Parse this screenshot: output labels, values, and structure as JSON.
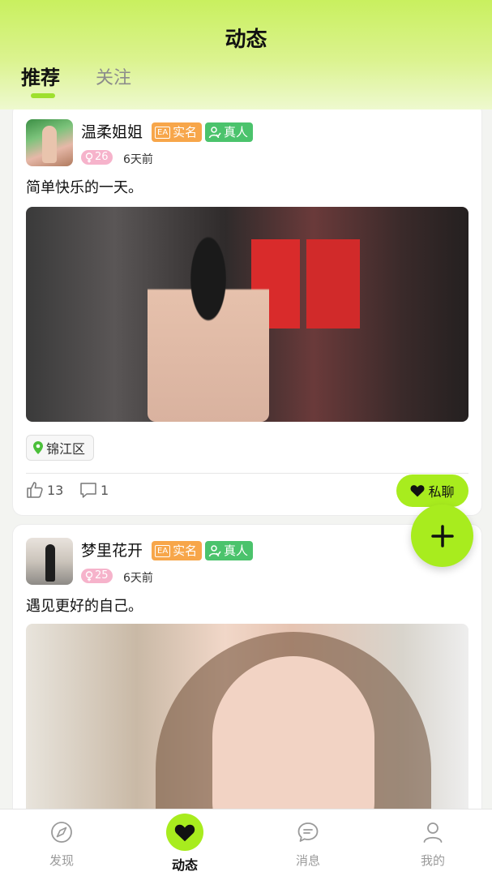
{
  "status_bar": {
    "left": "",
    "right": ""
  },
  "header": {
    "title": "动态",
    "tabs": [
      {
        "label": "推荐",
        "active": true
      },
      {
        "label": "关注",
        "active": false
      }
    ]
  },
  "posts": [
    {
      "username": "温柔姐姐",
      "badge_realname_icon": "EA",
      "badge_realname": "实名",
      "badge_realperson": "真人",
      "age": "26",
      "time": "6天前",
      "text": "简单快乐的一天。",
      "location": "锦江区",
      "likes": "13",
      "comments": "1",
      "chat_label": "私聊"
    },
    {
      "username": "梦里花开",
      "badge_realname_icon": "EA",
      "badge_realname": "实名",
      "badge_realperson": "真人",
      "age": "25",
      "time": "6天前",
      "text": "遇见更好的自己。"
    }
  ],
  "fab": {
    "icon": "plus-icon"
  },
  "bottom_nav": [
    {
      "label": "发现",
      "icon": "compass-icon",
      "active": false
    },
    {
      "label": "动态",
      "icon": "heart-icon",
      "active": true
    },
    {
      "label": "消息",
      "icon": "chat-bubble-icon",
      "active": false
    },
    {
      "label": "我的",
      "icon": "person-icon",
      "active": false
    }
  ],
  "colors": {
    "accent": "#a8ec1e",
    "header_top": "#c9f05f",
    "badge_realname": "#f7a64a",
    "badge_realperson": "#4bc36c",
    "age_badge": "#f6b3cb"
  }
}
